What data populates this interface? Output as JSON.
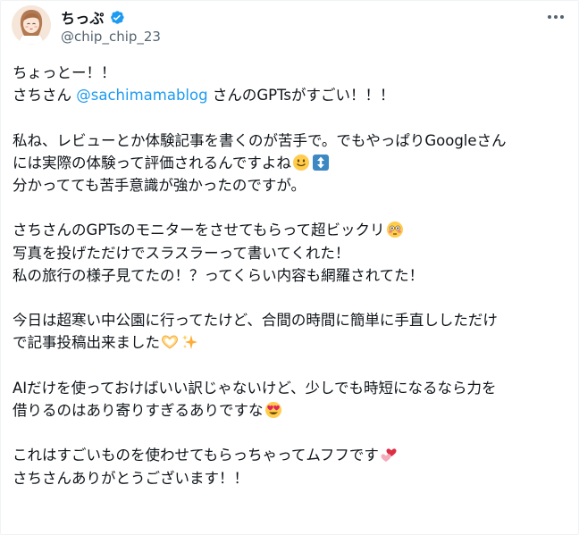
{
  "author": {
    "display_name": "ちっぷ",
    "handle": "@chip_chip_23",
    "verified": true,
    "avatar_icon": "avatar-illustration",
    "more_icon": "more-options-icon"
  },
  "tweet": {
    "p1": {
      "l1": "ちょっとー！！",
      "l2_pre": "さちさん ",
      "mention": "@sachimamablog",
      "l2_post": " さんのGPTsがすごい！！！"
    },
    "p2": {
      "l1": "私ね、レビューとか体験記事を書くのが苦手で。でもやっぱりGoogleさん",
      "l2": "には実際の体験って評価されるんですよね",
      "l3": "分かってても苦手意識が強かったのですが。"
    },
    "p3": {
      "l1": "さちさんのGPTsのモニターをさせてもらって超ビックリ",
      "l2": "写真を投げただけでスラスラーって書いてくれた！",
      "l3": "私の旅行の様子見てたの！？ってくらい内容も網羅されてた！"
    },
    "p4": {
      "l1": "今日は超寒い中公園に行ってたけど、合間の時間に簡単に手直ししただけ",
      "l2": "で記事投稿出来ました"
    },
    "p5": {
      "l1": "AIだけを使っておけばいい訳じゃないけど、少しでも時短になるなら力を",
      "l2": "借りるのはあり寄りすぎるありですな"
    },
    "p6": {
      "l1": "これはすごいものを使わせてもらっちゃってムフフです",
      "l2": "さちさんありがとうございます！！"
    }
  },
  "colors": {
    "text": "#0f1419",
    "secondary": "#536471",
    "link": "#1d9bf0",
    "verified": "#1d9bf0"
  }
}
